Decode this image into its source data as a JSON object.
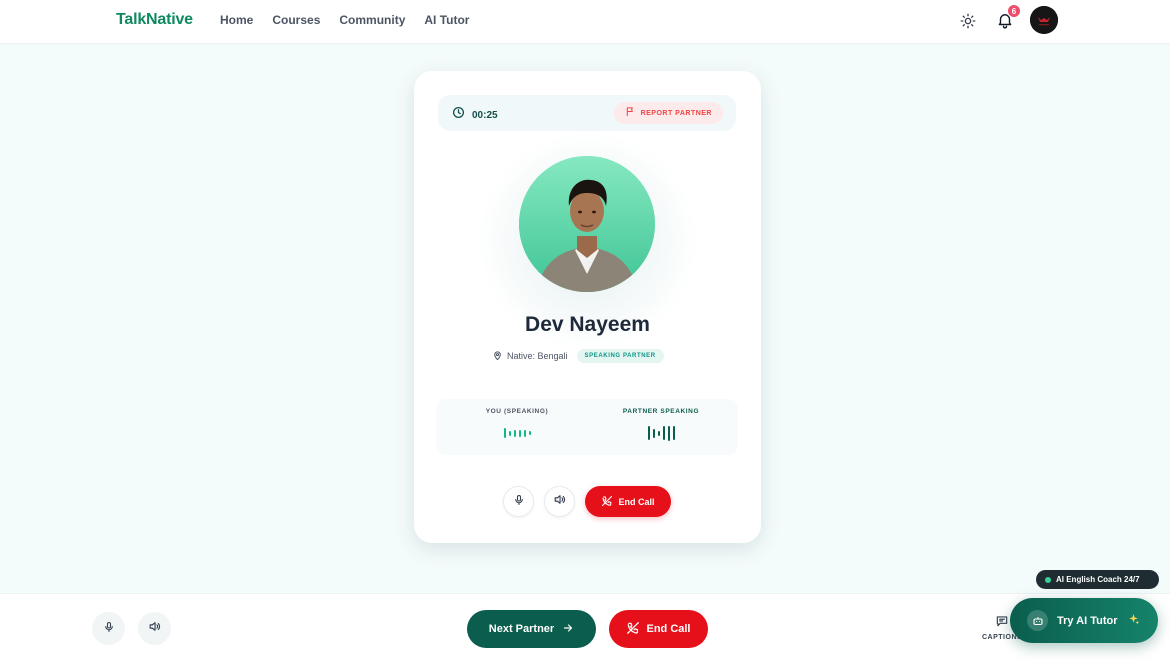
{
  "app": {
    "logo": "TalkNative"
  },
  "nav": {
    "items": [
      "Home",
      "Courses",
      "Community",
      "AI Tutor"
    ]
  },
  "header": {
    "notification_count": "6"
  },
  "call": {
    "timer": "00:25",
    "report_label": "REPORT PARTNER",
    "partner_name": "Dev Nayeem",
    "native_label": "Native: Bengali",
    "badge": "SPEAKING PARTNER",
    "you_label": "YOU (SPEAKING)",
    "partner_label": "PARTNER SPEAKING",
    "you_bar_levels": [
      0.8,
      0.4,
      0.5,
      0.5,
      0.5,
      0.3
    ],
    "partner_bar_levels": [
      0.9,
      0.6,
      0.3,
      0.9,
      1.0,
      0.9
    ],
    "end_call_label": "End Call"
  },
  "bottom": {
    "next_partner_label": "Next Partner",
    "end_call_label": "End Call",
    "captions_label": "CAPTIONS"
  },
  "assistant": {
    "coach_label": "AI English Coach 24/7",
    "try_label": "Try AI Tutor"
  },
  "colors": {
    "brand": "#0f8a5f",
    "primary_dark": "#0b5e4d",
    "danger": "#e5101a",
    "you_bars": "#10b981",
    "partner_bars": "#0b5e4d"
  }
}
